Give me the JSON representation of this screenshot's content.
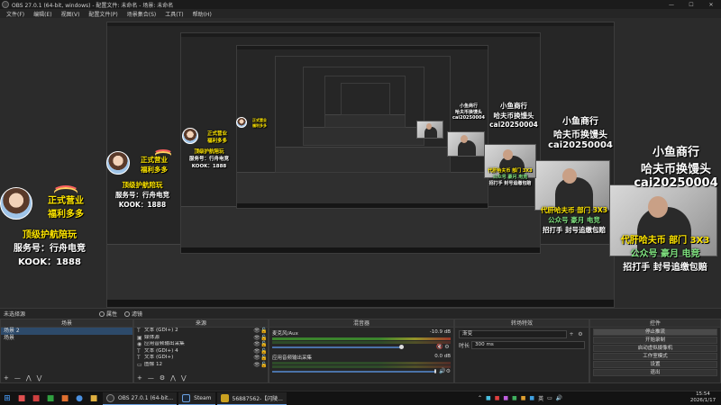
{
  "window": {
    "title": "OBS 27.0.1 (64-bit, windows) - 配置文件: 未命名 - 场景: 未命名",
    "minimize": "—",
    "maximize": "☐",
    "close": "✕"
  },
  "menu": [
    "文件(F)",
    "编辑(E)",
    "视图(V)",
    "配置文件(P)",
    "场景集合(S)",
    "工具(T)",
    "帮助(H)"
  ],
  "overlay": {
    "avatar_card": {
      "line1": "正式营业",
      "line2": "福利多多",
      "line3": "顶级护航陪玩",
      "line4": "服务号：行舟电竞",
      "line5": "KOOK：1888"
    },
    "shop_card": {
      "line1": "小鱼商行",
      "line2": "哈夫币换馒头",
      "line3": "cai20250004"
    },
    "promo_card": {
      "line1": "代肝哈夫币 部门 3X3",
      "line2": "公众号 豪月 电竞",
      "line3": "招打手 封号追缴包赔"
    }
  },
  "scene_bar": {
    "scene_name": "未选择源",
    "tab1": "属性",
    "tab2": "滤镜"
  },
  "docks": {
    "scenes": {
      "title": "场景",
      "items": [
        "场景 2",
        "场景"
      ],
      "footer_add": "+",
      "footer_remove": "—",
      "footer_up": "⋀",
      "footer_down": "⋁"
    },
    "sources": {
      "title": "来源",
      "items": [
        {
          "icon": "T",
          "text": "文本 (GDI+) 2"
        },
        {
          "icon": "▣",
          "text": "媒体源"
        },
        {
          "icon": "◉",
          "text": "应用音频输出采集"
        },
        {
          "icon": "T",
          "text": "文本 (GDI+) 4"
        },
        {
          "icon": "T",
          "text": "文本 (GDI+)"
        },
        {
          "icon": "▭",
          "text": "图像 12"
        }
      ],
      "footer_add": "+",
      "footer_remove": "—",
      "footer_gear": "⚙",
      "footer_up": "⋀",
      "footer_down": "⋁"
    },
    "mixer": {
      "title": "混音器",
      "channels": [
        {
          "name": "麦克风/Aux",
          "db": "-10.9 dB"
        },
        {
          "name": "应用音频输出采集",
          "db": "0.0 dB"
        }
      ]
    },
    "transitions": {
      "title": "转场特效",
      "transition_value": "渐变",
      "duration_label": "时长",
      "duration_value": "300 ms",
      "add_symbol": "+",
      "gear_symbol": "⚙"
    },
    "controls": {
      "title": "控件",
      "buttons": [
        "停止推流",
        "开始录制",
        "启动虚拟摄像机",
        "工作室模式",
        "设置",
        "退出"
      ]
    }
  },
  "taskbar": {
    "apps": [
      {
        "label": "OBS 27.0.1 (64-bit...",
        "color": "#303030"
      },
      {
        "label": "Steam",
        "color": "#1b2838"
      },
      {
        "label": "56887562-【闪陵...",
        "color": "#c9a020"
      }
    ],
    "tray": {
      "ime": "英",
      "clock_time": "15:54",
      "clock_date": "2026/1/17"
    }
  },
  "colors": {
    "accent": "#4a72a8",
    "promo_yellow": "#ffe600"
  }
}
